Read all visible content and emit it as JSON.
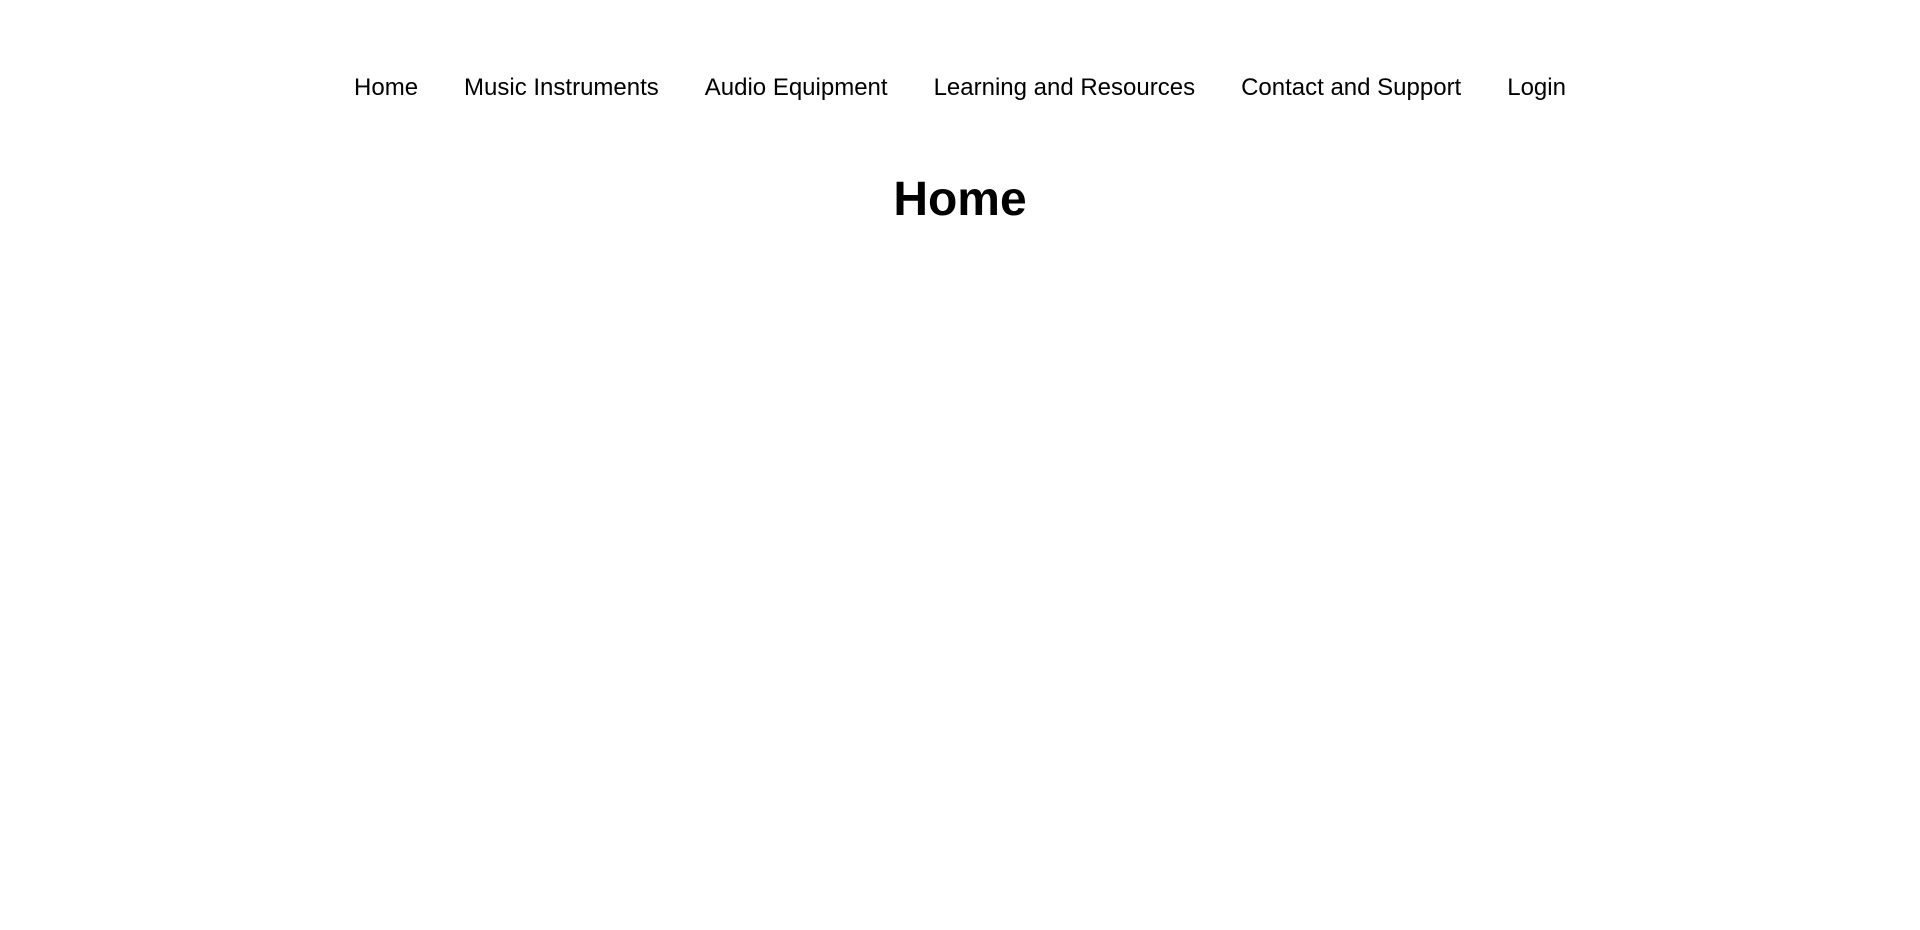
{
  "nav": {
    "items": [
      {
        "label": "Home"
      },
      {
        "label": "Music Instruments"
      },
      {
        "label": "Audio Equipment"
      },
      {
        "label": "Learning and Resources"
      },
      {
        "label": "Contact and Support"
      },
      {
        "label": "Login"
      }
    ]
  },
  "main": {
    "title": "Home"
  },
  "colors": {
    "background": "#ffffff",
    "text": "#000000"
  }
}
